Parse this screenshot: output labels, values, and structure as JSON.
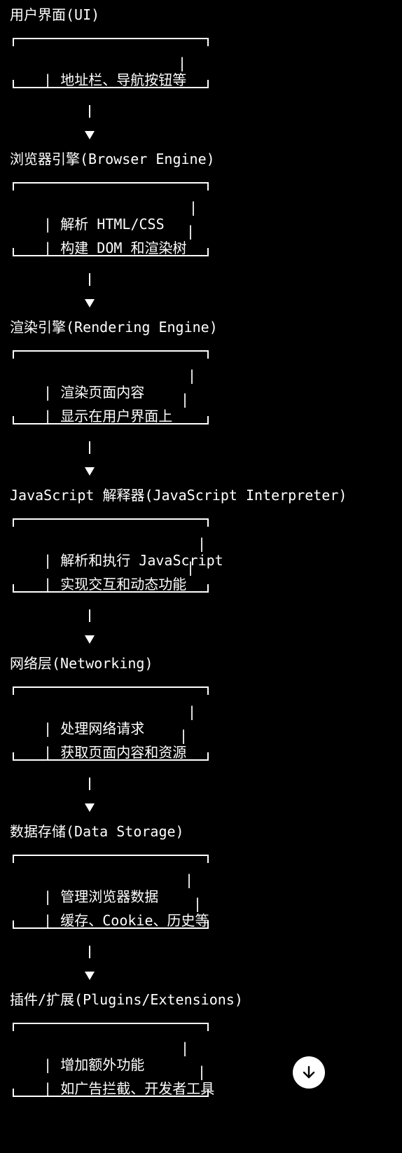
{
  "sections": [
    {
      "title": "用户界面(UI)",
      "lines": [
        "地址栏、导航按钮等"
      ]
    },
    {
      "title": "浏览器引擎(Browser Engine)",
      "lines": [
        "解析 HTML/CSS",
        "构建 DOM 和渲染树"
      ]
    },
    {
      "title": "渲染引擎(Rendering Engine)",
      "lines": [
        "渲染页面内容",
        "显示在用户界面上"
      ]
    },
    {
      "title": "JavaScript 解释器(JavaScript Interpreter)",
      "lines": [
        "解析和执行 JavaScript",
        "实现交互和动态功能"
      ]
    },
    {
      "title": "网络层(Networking)",
      "lines": [
        "处理网络请求",
        "获取页面内容和资源"
      ]
    },
    {
      "title": "数据存储(Data Storage)",
      "lines": [
        "管理浏览器数据",
        "缓存、Cookie、历史等"
      ]
    },
    {
      "title": "插件/扩展(Plugins/Extensions)",
      "lines": [
        "增加额外功能",
        "如广告拦截、开发者工具"
      ]
    }
  ],
  "scroll_button": {
    "icon": "arrow-down-icon"
  }
}
